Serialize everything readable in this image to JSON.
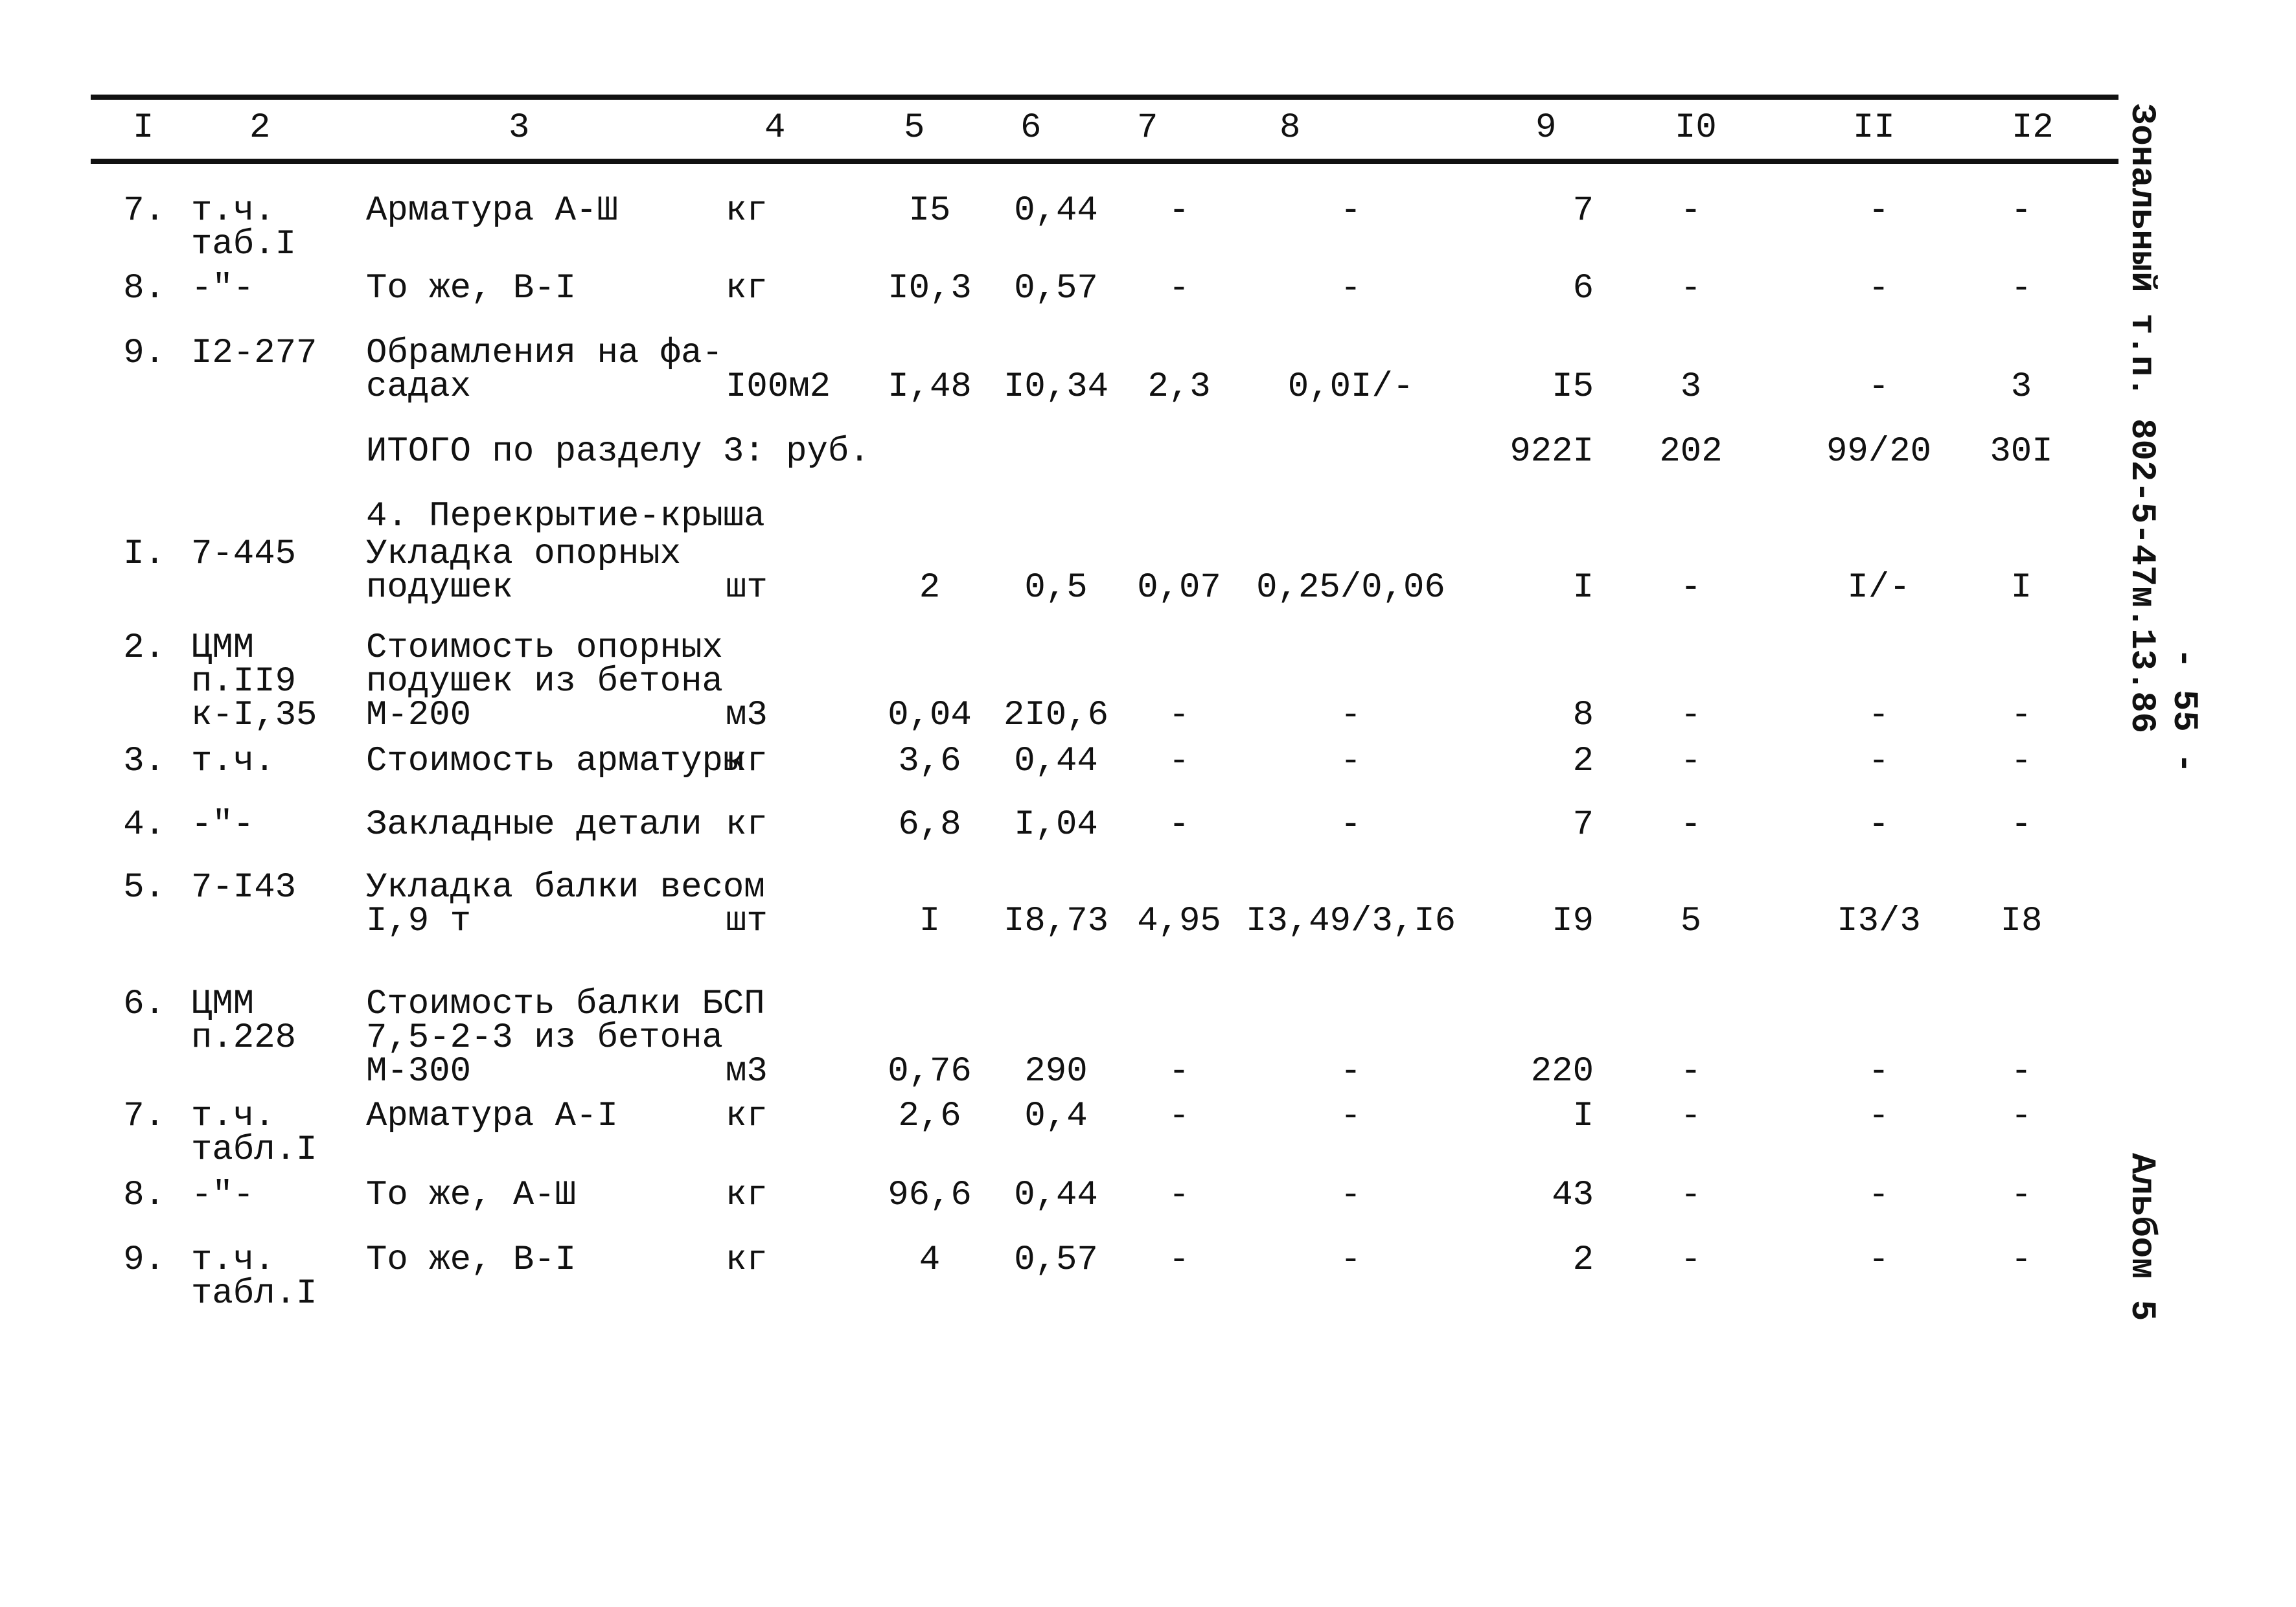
{
  "header": {
    "columns": [
      "I",
      "2",
      "3",
      "4",
      "5",
      "6",
      "7",
      "8",
      "9",
      "I0",
      "II",
      "I2"
    ]
  },
  "rows_a": [
    {
      "n": "7.",
      "code": "т.ч.\nтаб.I",
      "name": "Арматура А-Ш",
      "unit": "кг",
      "c5": "I5",
      "c6": "0,44",
      "c7": "-",
      "c8": "-",
      "c9": "7",
      "c10": "-",
      "c11": "-",
      "c12": "-"
    },
    {
      "n": "8.",
      "code": "-\"-",
      "name": "То же, В-I",
      "unit": "кг",
      "c5": "I0,3",
      "c6": "0,57",
      "c7": "-",
      "c8": "-",
      "c9": "6",
      "c10": "-",
      "c11": "-",
      "c12": "-"
    },
    {
      "n": "9.",
      "code": "I2-277",
      "name": "Обрамления на фа-\nсадах",
      "unit": "I00м2",
      "c5": "I,48",
      "c6": "I0,34",
      "c7": "2,3",
      "c8": "0,0I/-",
      "c9": "I5",
      "c10": "3",
      "c11": "-",
      "c12": "3"
    }
  ],
  "total": {
    "label": "ИТОГО по разделу 3: руб.",
    "c9": "922I",
    "c10": "202",
    "c11": "99/20",
    "c12": "30I"
  },
  "section_title": "4. Перекрытие-крыша",
  "rows_b": [
    {
      "n": "I.",
      "code": "7-445",
      "name": "Укладка опорных\nподушек",
      "unit": "шт",
      "c5": "2",
      "c6": "0,5",
      "c7": "0,07",
      "c8": "0,25/0,06",
      "c9": "I",
      "c10": "-",
      "c11": "I/-",
      "c12": "I"
    },
    {
      "n": "2.",
      "code": "ЦММ\nп.II9\nк-I,35",
      "name": "Стоимость опорных\nподушек из бетона\nМ-200",
      "unit": "м3",
      "c5": "0,04",
      "c6": "2I0,6",
      "c7": "-",
      "c8": "-",
      "c9": "8",
      "c10": "-",
      "c11": "-",
      "c12": "-"
    },
    {
      "n": "3.",
      "code": "т.ч.",
      "name": "Стоимость арматуры",
      "unit": "кг",
      "c5": "3,6",
      "c6": "0,44",
      "c7": "-",
      "c8": "-",
      "c9": "2",
      "c10": "-",
      "c11": "-",
      "c12": "-"
    },
    {
      "n": "4.",
      "code": "-\"-",
      "name": "Закладные детали",
      "unit": "кг",
      "c5": "6,8",
      "c6": "I,04",
      "c7": "-",
      "c8": "-",
      "c9": "7",
      "c10": "-",
      "c11": "-",
      "c12": "-"
    },
    {
      "n": "5.",
      "code": "7-I43",
      "name": "Укладка балки весом\nI,9 т",
      "unit": "шт",
      "c5": "I",
      "c6": "I8,73",
      "c7": "4,95",
      "c8": "I3,49/3,I6",
      "c9": "I9",
      "c10": "5",
      "c11": "I3/3",
      "c12": "I8"
    },
    {
      "n": "6.",
      "code": "ЦММ\nп.228",
      "name": "Стоимость балки БСП\n7,5-2-3 из бетона\nМ-300",
      "unit": "м3",
      "c5": "0,76",
      "c6": "290",
      "c7": "-",
      "c8": "-",
      "c9": "220",
      "c10": "-",
      "c11": "-",
      "c12": "-"
    },
    {
      "n": "7.",
      "code": "т.ч.\nтабл.I",
      "name": "Арматура А-I",
      "unit": "кг",
      "c5": "2,6",
      "c6": "0,4",
      "c7": "-",
      "c8": "-",
      "c9": "I",
      "c10": "-",
      "c11": "-",
      "c12": "-"
    },
    {
      "n": "8.",
      "code": "-\"-",
      "name": "То же, А-Ш",
      "unit": "кг",
      "c5": "96,6",
      "c6": "0,44",
      "c7": "-",
      "c8": "-",
      "c9": "43",
      "c10": "-",
      "c11": "-",
      "c12": "-"
    },
    {
      "n": "9.",
      "code": "т.ч.\nтабл.I",
      "name": "То же, В-I",
      "unit": "кг",
      "c5": "4",
      "c6": "0,57",
      "c7": "-",
      "c8": "-",
      "c9": "2",
      "c10": "-",
      "c11": "-",
      "c12": "-"
    }
  ],
  "margin": {
    "project": "Зональный т.п. 802-5-47м.13.86",
    "page": "- 55 -",
    "album": "Альбом 5"
  }
}
